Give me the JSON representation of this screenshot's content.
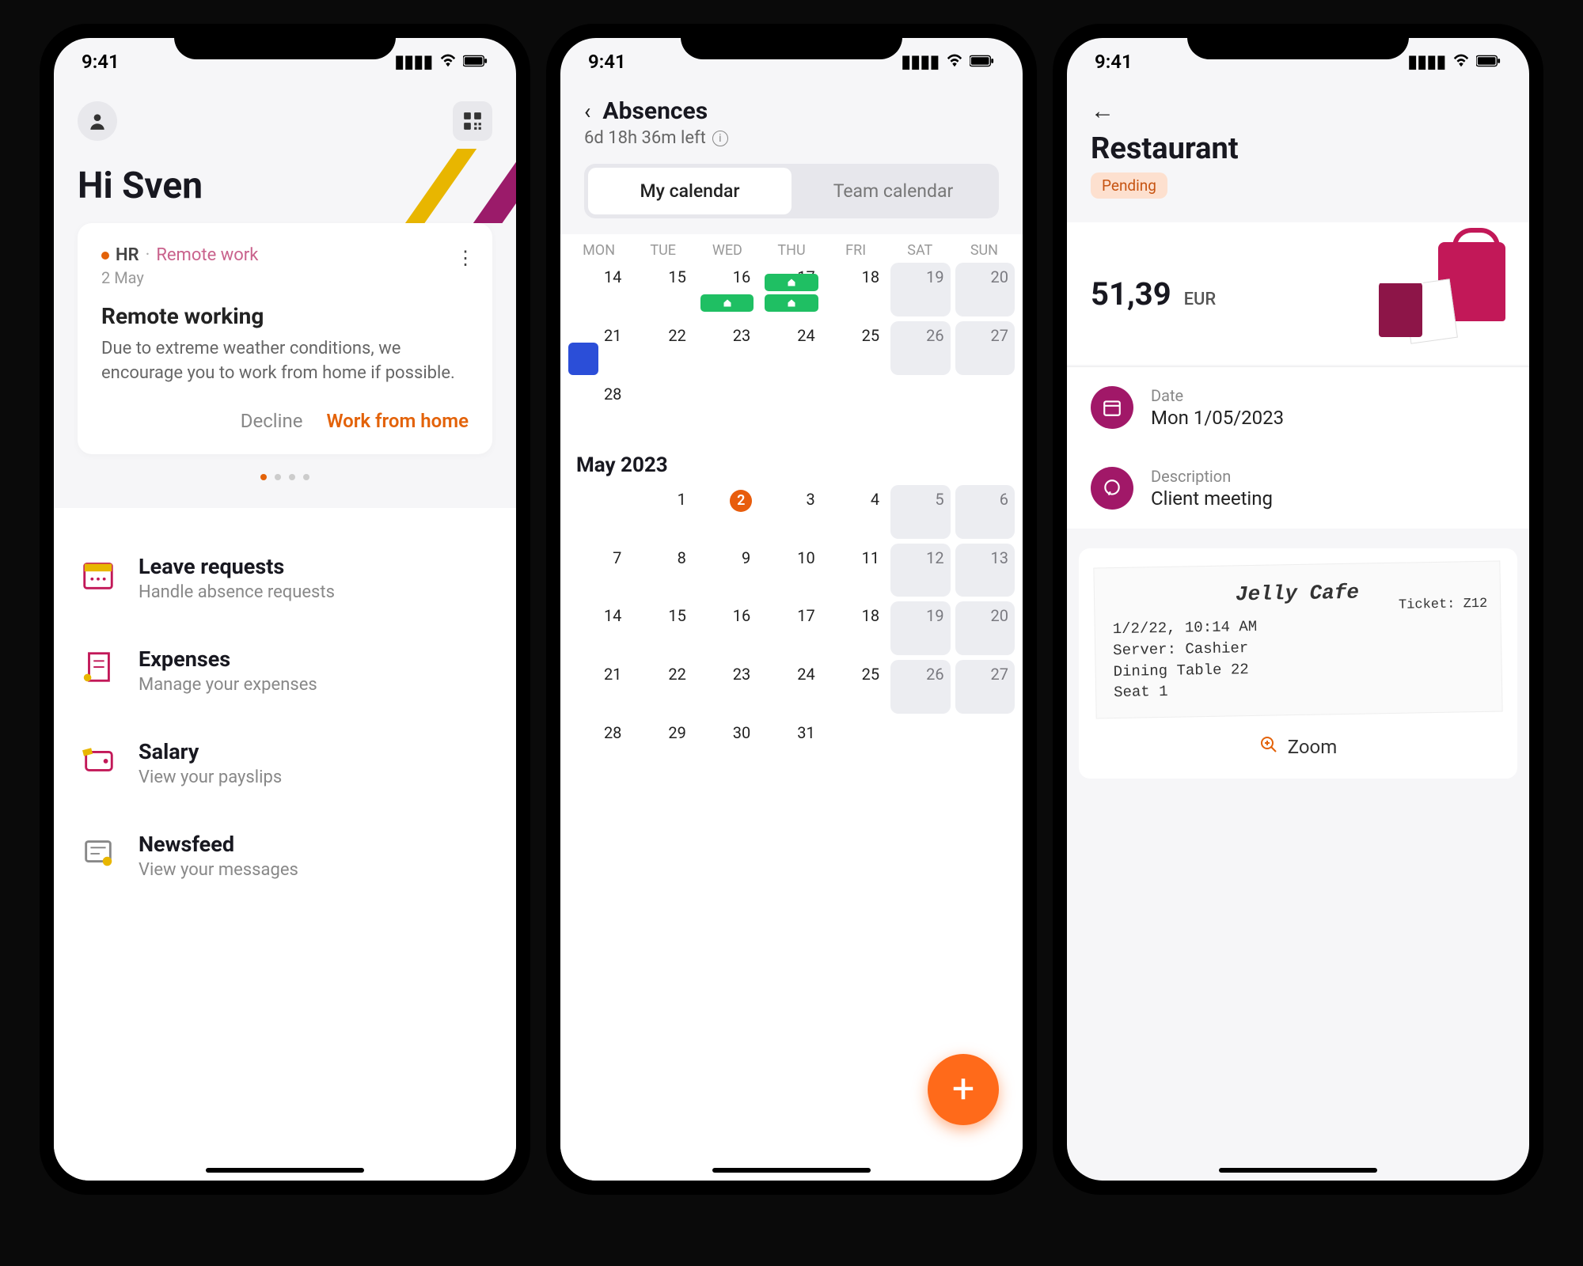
{
  "status": {
    "time": "9:41"
  },
  "screen1": {
    "greeting": "Hi Sven",
    "card": {
      "tag_hr": "HR",
      "tag_topic": "Remote work",
      "date": "2 May",
      "title": "Remote working",
      "body": "Due to extreme weather conditions, we encourage you to work from home if possible.",
      "decline": "Decline",
      "accept": "Work from home"
    },
    "menu": [
      {
        "title": "Leave requests",
        "sub": "Handle absence requests"
      },
      {
        "title": "Expenses",
        "sub": "Manage your expenses"
      },
      {
        "title": "Salary",
        "sub": "View your payslips"
      },
      {
        "title": "Newsfeed",
        "sub": "View your messages"
      }
    ]
  },
  "screen2": {
    "title": "Absences",
    "subtitle": "6d 18h 36m left",
    "tab_my": "My calendar",
    "tab_team": "Team calendar",
    "weekdays": [
      "MON",
      "TUE",
      "WED",
      "THU",
      "FRI",
      "SAT",
      "SUN"
    ],
    "april_rows": [
      [
        "14",
        "15",
        "16",
        "17",
        "18",
        "19",
        "20"
      ],
      [
        "21",
        "22",
        "23",
        "24",
        "25",
        "26",
        "27"
      ],
      [
        "28",
        "",
        "",
        "",
        "",
        "",
        ""
      ]
    ],
    "may_label": "May 2023",
    "may_rows": [
      [
        "",
        "1",
        "2",
        "3",
        "4",
        "5",
        "6"
      ],
      [
        "7",
        "8",
        "9",
        "10",
        "11",
        "12",
        "13"
      ],
      [
        "14",
        "15",
        "16",
        "17",
        "18",
        "19",
        "20"
      ],
      [
        "21",
        "22",
        "23",
        "24",
        "25",
        "26",
        "27"
      ],
      [
        "28",
        "29",
        "30",
        "31",
        "",
        "",
        ""
      ]
    ],
    "fab": "+"
  },
  "screen3": {
    "title": "Restaurant",
    "status": "Pending",
    "amount": "51,39",
    "currency": "EUR",
    "date_label": "Date",
    "date_value": "Mon 1/05/2023",
    "desc_label": "Description",
    "desc_value": "Client meeting",
    "receipt": {
      "name": "Jelly Cafe",
      "line1": "1/2/22, 10:14 AM",
      "line2": "Server: Cashier",
      "line3": "Dining Table 22",
      "line4": "Seat 1",
      "ticket": "Ticket: Z12"
    },
    "zoom": "Zoom"
  }
}
